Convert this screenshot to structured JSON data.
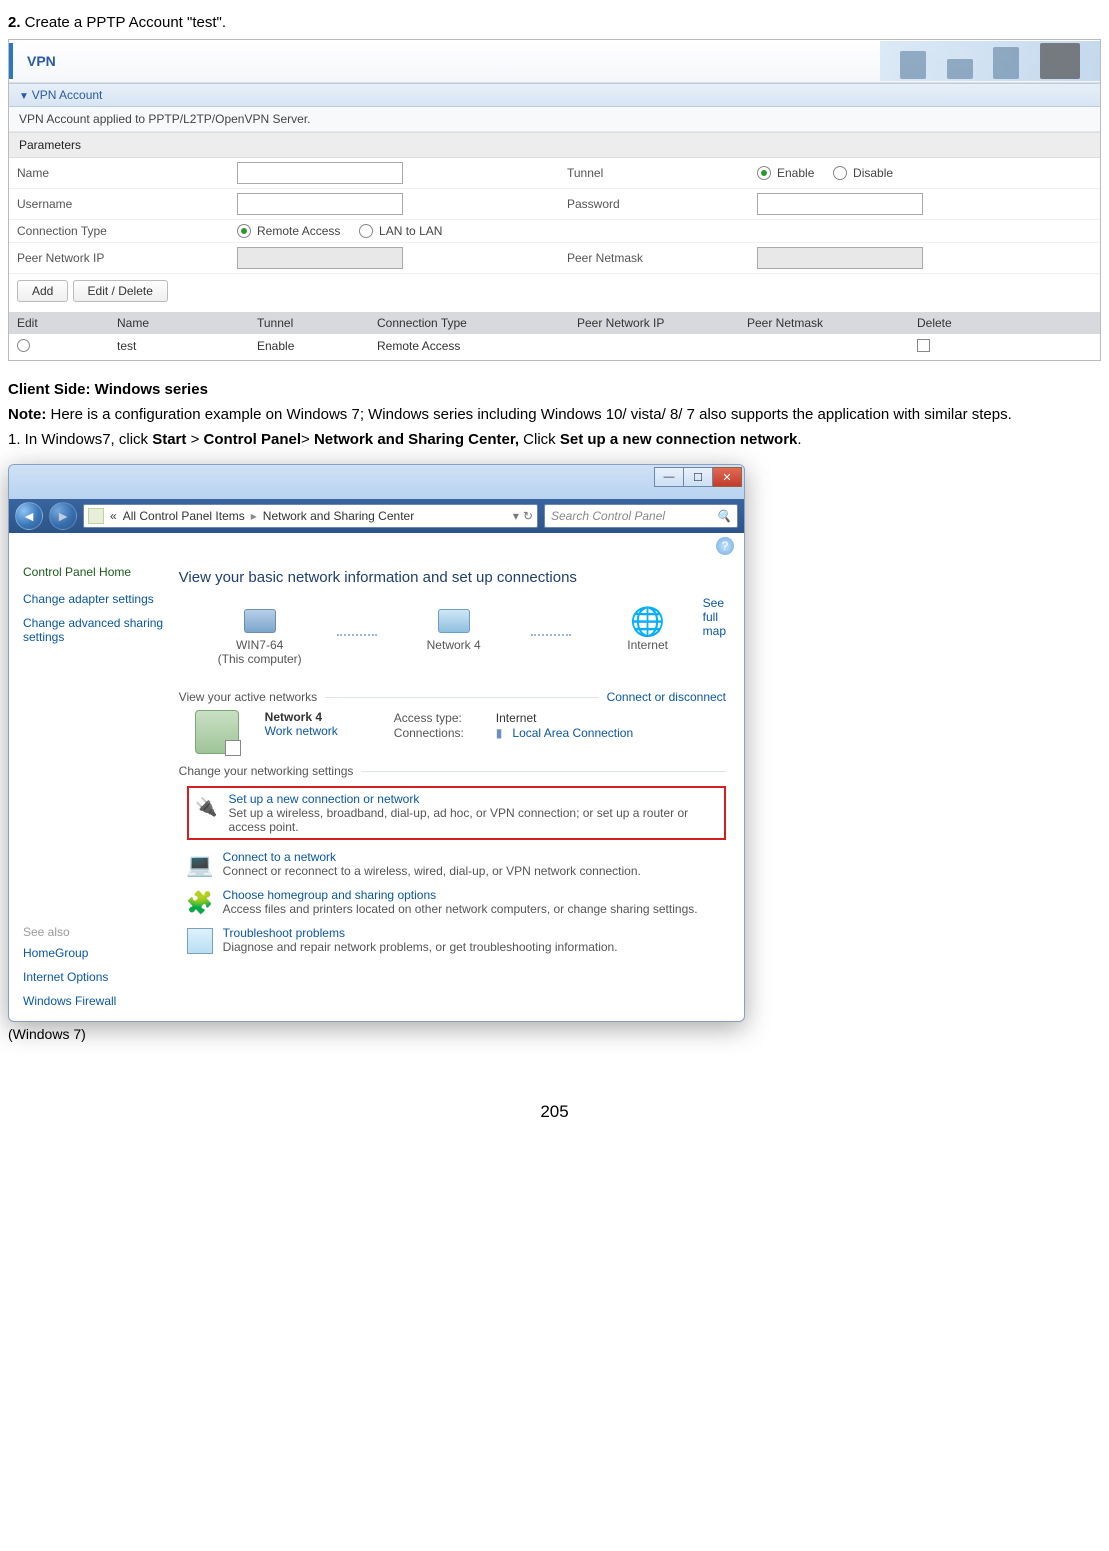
{
  "doc": {
    "step2": {
      "bold": "2.",
      "text": " Create a PPTP Account \"test\"."
    },
    "clientSideHeading": "Client Side: Windows series",
    "noteLabel": "Note:",
    "noteText": " Here is a configuration example on Windows 7; Windows series including Windows 10/ vista/ 8/ 7 also supports the application with similar steps.",
    "step1_prefix": "1. In Windows7, click ",
    "start": "Start",
    "gt1": " > ",
    "cp": "Control Panel",
    "gt2": "> ",
    "nsc": "Network and Sharing Center,",
    "clickWord": " Click ",
    "setnew": "Set up a new connection network",
    "period": ".",
    "caption": "(Windows 7)",
    "pagenum": "205"
  },
  "vpn": {
    "tab": "VPN",
    "section": "VPN Account",
    "desc": "VPN Account applied to PPTP/L2TP/OpenVPN Server.",
    "parameters": "Parameters",
    "labels": {
      "name": "Name",
      "tunnel": "Tunnel",
      "enable": "Enable",
      "disable": "Disable",
      "username": "Username",
      "password": "Password",
      "conntype": "Connection Type",
      "remote": "Remote Access",
      "lan": "LAN to LAN",
      "peerip": "Peer Network IP",
      "peermask": "Peer Netmask"
    },
    "buttons": {
      "add": "Add",
      "editdel": "Edit / Delete"
    },
    "list": {
      "headers": {
        "edit": "Edit",
        "name": "Name",
        "tunnel": "Tunnel",
        "conn": "Connection Type",
        "peerip": "Peer Network IP",
        "peermask": "Peer Netmask",
        "delete": "Delete"
      },
      "row0": {
        "name": "test",
        "tunnel": "Enable",
        "conn": "Remote Access",
        "peerip": "",
        "peermask": ""
      }
    }
  },
  "win7": {
    "breadcrumb": {
      "chev": "«",
      "seg1": "All Control Panel Items",
      "seg2": "Network and Sharing Center"
    },
    "searchPlaceholder": "Search Control Panel",
    "side": {
      "home": "Control Panel Home",
      "adapter": "Change adapter settings",
      "advanced": "Change advanced sharing settings",
      "seealso": "See also",
      "homegroup": "HomeGroup",
      "inetopt": "Internet Options",
      "firewall": "Windows Firewall"
    },
    "main": {
      "heading": "View your basic network information and set up connections",
      "seefull": "See full map",
      "nodes": {
        "pc": "WIN7-64",
        "pcSub": "(This computer)",
        "net": "Network  4",
        "inet": "Internet"
      },
      "viewActive": "View your active networks",
      "connDisc": "Connect or disconnect",
      "active": {
        "name": "Network  4",
        "type": "Work network",
        "accessLbl": "Access type:",
        "accessVal": "Internet",
        "connLbl": "Connections:",
        "connVal": "Local Area Connection"
      },
      "changeHead": "Change your networking settings",
      "tasks": {
        "setup": {
          "title": "Set up a new connection or network",
          "sub": "Set up a wireless, broadband, dial-up, ad hoc, or VPN connection; or set up a router or access point."
        },
        "connect": {
          "title": "Connect to a network",
          "sub": "Connect or reconnect to a wireless, wired, dial-up, or VPN network connection."
        },
        "hg": {
          "title": "Choose homegroup and sharing options",
          "sub": "Access files and printers located on other network computers, or change sharing settings."
        },
        "ts": {
          "title": "Troubleshoot problems",
          "sub": "Diagnose and repair network problems, or get troubleshooting information."
        }
      }
    }
  }
}
